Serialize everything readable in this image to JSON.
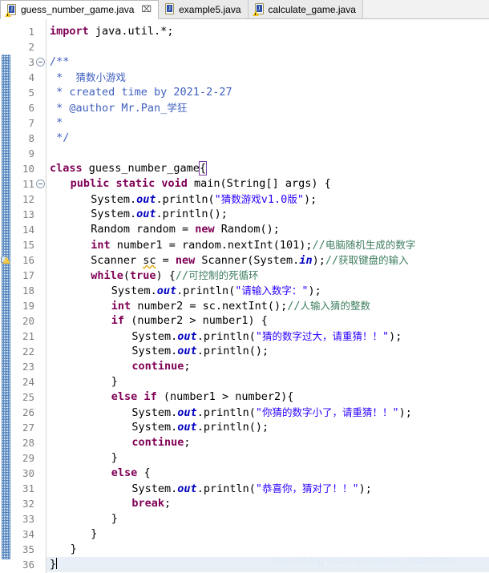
{
  "window": {
    "app": "Eclipse IDE - Java Editor",
    "watermark": "https://blog.csdn.net/weixin_43408020"
  },
  "tabs": [
    {
      "label": "guess_number_game.java",
      "icon": "java-file-warning-icon",
      "active": true,
      "close_glyph": "⌧"
    },
    {
      "label": "example5.java",
      "icon": "java-file-icon",
      "active": false,
      "close_glyph": ""
    },
    {
      "label": "calculate_game.java",
      "icon": "java-file-warning-icon",
      "active": false,
      "close_glyph": ""
    }
  ],
  "editor": {
    "language": "Java",
    "file": "guess_number_game.java",
    "cursor_line": 36,
    "fold_markers": [
      3,
      11
    ],
    "warning_markers": [
      16
    ],
    "line_count": 36,
    "colors": {
      "keyword": "#7f0055",
      "string": "#2a00ff",
      "comment": "#3f7f5f",
      "javadoc": "#3f5fbf",
      "field": "#0000c0",
      "current_line": "#e8eff7",
      "gutter_text": "#808080",
      "change_bar": "#4f81bd"
    },
    "line_numbers": [
      "1",
      "2",
      "3",
      "4",
      "5",
      "6",
      "7",
      "8",
      "9",
      "10",
      "11",
      "12",
      "13",
      "14",
      "15",
      "16",
      "17",
      "18",
      "19",
      "20",
      "21",
      "22",
      "23",
      "24",
      "25",
      "26",
      "27",
      "28",
      "29",
      "30",
      "31",
      "32",
      "33",
      "34",
      "35",
      "36"
    ],
    "lines": [
      {
        "n": 1,
        "indent": 0,
        "tokens": [
          {
            "t": "kw",
            "s": "import"
          },
          {
            "t": "plain",
            "s": " java.util.*;"
          }
        ]
      },
      {
        "n": 2,
        "indent": 0,
        "tokens": []
      },
      {
        "n": 3,
        "indent": 0,
        "tokens": [
          {
            "t": "jdoc",
            "s": "/**"
          }
        ]
      },
      {
        "n": 4,
        "indent": 0,
        "tokens": [
          {
            "t": "jdoc",
            "s": " *  "
          },
          {
            "t": "jdoc cjk",
            "s": "猜数小游戏"
          }
        ]
      },
      {
        "n": 5,
        "indent": 0,
        "tokens": [
          {
            "t": "jdoc",
            "s": " * created time by 2021-2-27"
          }
        ]
      },
      {
        "n": 6,
        "indent": 0,
        "tokens": [
          {
            "t": "jdoc",
            "s": " * @author Mr.Pan_"
          },
          {
            "t": "jdoc cjk",
            "s": "学狂"
          }
        ]
      },
      {
        "n": 7,
        "indent": 0,
        "tokens": [
          {
            "t": "jdoc",
            "s": " *"
          }
        ]
      },
      {
        "n": 8,
        "indent": 0,
        "tokens": [
          {
            "t": "jdoc",
            "s": " */"
          }
        ]
      },
      {
        "n": 9,
        "indent": 0,
        "tokens": []
      },
      {
        "n": 10,
        "indent": 0,
        "tokens": [
          {
            "t": "kw",
            "s": "class"
          },
          {
            "t": "plain",
            "s": " guess_number_game"
          },
          {
            "t": "plain bmatch",
            "s": "{"
          }
        ]
      },
      {
        "n": 11,
        "indent": 1,
        "tokens": [
          {
            "t": "kw",
            "s": "public static void"
          },
          {
            "t": "plain",
            "s": " main(String[] args) {"
          }
        ]
      },
      {
        "n": 12,
        "indent": 2,
        "tokens": [
          {
            "t": "plain",
            "s": "System."
          },
          {
            "t": "fld",
            "s": "out"
          },
          {
            "t": "plain",
            "s": ".println("
          },
          {
            "t": "str",
            "s": "\""
          },
          {
            "t": "str cjk",
            "s": "猜数游戏"
          },
          {
            "t": "str",
            "s": "v1.0"
          },
          {
            "t": "str cjk",
            "s": "版"
          },
          {
            "t": "str",
            "s": "\""
          },
          {
            "t": "plain",
            "s": ");"
          }
        ]
      },
      {
        "n": 13,
        "indent": 2,
        "tokens": [
          {
            "t": "plain",
            "s": "System."
          },
          {
            "t": "fld",
            "s": "out"
          },
          {
            "t": "plain",
            "s": ".println();"
          }
        ]
      },
      {
        "n": 14,
        "indent": 2,
        "tokens": [
          {
            "t": "plain",
            "s": "Random random = "
          },
          {
            "t": "kw",
            "s": "new"
          },
          {
            "t": "plain",
            "s": " Random();"
          }
        ]
      },
      {
        "n": 15,
        "indent": 2,
        "tokens": [
          {
            "t": "kw",
            "s": "int"
          },
          {
            "t": "plain",
            "s": " number1 = random.nextInt(101);"
          },
          {
            "t": "cmt",
            "s": "//"
          },
          {
            "t": "cmt cjk",
            "s": "电脑随机生成的数字"
          }
        ]
      },
      {
        "n": 16,
        "indent": 2,
        "tokens": [
          {
            "t": "plain",
            "s": "Scanner "
          },
          {
            "t": "plain squig",
            "s": "sc"
          },
          {
            "t": "plain",
            "s": " = "
          },
          {
            "t": "kw",
            "s": "new"
          },
          {
            "t": "plain",
            "s": " Scanner(System."
          },
          {
            "t": "fld",
            "s": "in"
          },
          {
            "t": "plain",
            "s": ");"
          },
          {
            "t": "cmt",
            "s": "//"
          },
          {
            "t": "cmt cjk",
            "s": "获取键盘的输入"
          }
        ]
      },
      {
        "n": 17,
        "indent": 2,
        "tokens": [
          {
            "t": "kw",
            "s": "while"
          },
          {
            "t": "plain",
            "s": "("
          },
          {
            "t": "kw",
            "s": "true"
          },
          {
            "t": "plain",
            "s": ") {"
          },
          {
            "t": "cmt",
            "s": "//"
          },
          {
            "t": "cmt cjk",
            "s": "可控制的死循环"
          }
        ]
      },
      {
        "n": 18,
        "indent": 3,
        "tokens": [
          {
            "t": "plain",
            "s": "System."
          },
          {
            "t": "fld",
            "s": "out"
          },
          {
            "t": "plain",
            "s": ".println("
          },
          {
            "t": "str",
            "s": "\""
          },
          {
            "t": "str cjk",
            "s": "请输入数字："
          },
          {
            "t": "str",
            "s": "\""
          },
          {
            "t": "plain",
            "s": ");"
          }
        ]
      },
      {
        "n": 19,
        "indent": 3,
        "tokens": [
          {
            "t": "kw",
            "s": "int"
          },
          {
            "t": "plain",
            "s": " number2 = sc.nextInt();"
          },
          {
            "t": "cmt",
            "s": "//"
          },
          {
            "t": "cmt cjk",
            "s": "人输入猜的整数"
          }
        ]
      },
      {
        "n": 20,
        "indent": 3,
        "tokens": [
          {
            "t": "kw",
            "s": "if"
          },
          {
            "t": "plain",
            "s": " (number2 > number1) {"
          }
        ]
      },
      {
        "n": 21,
        "indent": 4,
        "tokens": [
          {
            "t": "plain",
            "s": "System."
          },
          {
            "t": "fld",
            "s": "out"
          },
          {
            "t": "plain",
            "s": ".println("
          },
          {
            "t": "str",
            "s": "\""
          },
          {
            "t": "str cjk",
            "s": "猜的数字过大，请重猜！！"
          },
          {
            "t": "str",
            "s": "\""
          },
          {
            "t": "plain",
            "s": ");"
          }
        ]
      },
      {
        "n": 22,
        "indent": 4,
        "tokens": [
          {
            "t": "plain",
            "s": "System."
          },
          {
            "t": "fld",
            "s": "out"
          },
          {
            "t": "plain",
            "s": ".println();"
          }
        ]
      },
      {
        "n": 23,
        "indent": 4,
        "tokens": [
          {
            "t": "kw",
            "s": "continue"
          },
          {
            "t": "plain",
            "s": ";"
          }
        ]
      },
      {
        "n": 24,
        "indent": 3,
        "tokens": [
          {
            "t": "plain",
            "s": "}"
          }
        ]
      },
      {
        "n": 25,
        "indent": 3,
        "tokens": [
          {
            "t": "kw",
            "s": "else if"
          },
          {
            "t": "plain",
            "s": " (number1 > number2){"
          }
        ]
      },
      {
        "n": 26,
        "indent": 4,
        "tokens": [
          {
            "t": "plain",
            "s": "System."
          },
          {
            "t": "fld",
            "s": "out"
          },
          {
            "t": "plain",
            "s": ".println("
          },
          {
            "t": "str",
            "s": "\""
          },
          {
            "t": "str cjk",
            "s": "你猜的数字小了，请重猜！！"
          },
          {
            "t": "str",
            "s": "\""
          },
          {
            "t": "plain",
            "s": ");"
          }
        ]
      },
      {
        "n": 27,
        "indent": 4,
        "tokens": [
          {
            "t": "plain",
            "s": "System."
          },
          {
            "t": "fld",
            "s": "out"
          },
          {
            "t": "plain",
            "s": ".println();"
          }
        ]
      },
      {
        "n": 28,
        "indent": 4,
        "tokens": [
          {
            "t": "kw",
            "s": "continue"
          },
          {
            "t": "plain",
            "s": ";"
          }
        ]
      },
      {
        "n": 29,
        "indent": 3,
        "tokens": [
          {
            "t": "plain",
            "s": "}"
          }
        ]
      },
      {
        "n": 30,
        "indent": 3,
        "tokens": [
          {
            "t": "kw",
            "s": "else"
          },
          {
            "t": "plain",
            "s": " {"
          }
        ]
      },
      {
        "n": 31,
        "indent": 4,
        "tokens": [
          {
            "t": "plain",
            "s": "System."
          },
          {
            "t": "fld",
            "s": "out"
          },
          {
            "t": "plain",
            "s": ".println("
          },
          {
            "t": "str",
            "s": "\""
          },
          {
            "t": "str cjk",
            "s": "恭喜你，猜对了！！"
          },
          {
            "t": "str",
            "s": "\""
          },
          {
            "t": "plain",
            "s": ");"
          }
        ]
      },
      {
        "n": 32,
        "indent": 4,
        "tokens": [
          {
            "t": "kw",
            "s": "break"
          },
          {
            "t": "plain",
            "s": ";"
          }
        ]
      },
      {
        "n": 33,
        "indent": 3,
        "tokens": [
          {
            "t": "plain",
            "s": "}"
          }
        ]
      },
      {
        "n": 34,
        "indent": 2,
        "tokens": [
          {
            "t": "plain",
            "s": "}"
          }
        ]
      },
      {
        "n": 35,
        "indent": 1,
        "tokens": [
          {
            "t": "plain",
            "s": "}"
          }
        ]
      },
      {
        "n": 36,
        "indent": 0,
        "tokens": [
          {
            "t": "plain",
            "s": "}"
          }
        ],
        "current": true,
        "caret_after": true
      }
    ]
  }
}
